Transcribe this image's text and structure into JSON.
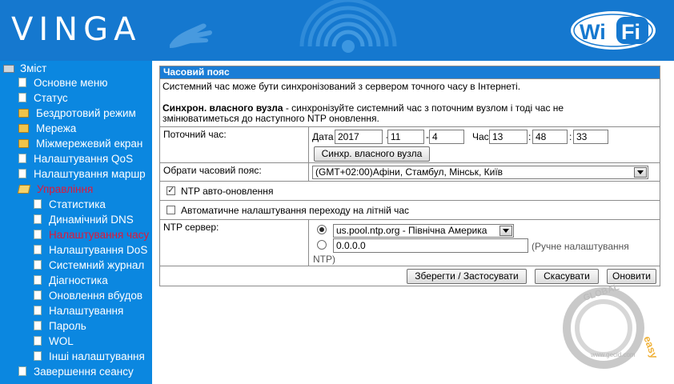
{
  "header": {
    "brand": "VINGA",
    "wifi_logo": {
      "left": "Wi",
      "right": "Fi"
    }
  },
  "sidebar": {
    "root": "Зміст",
    "items": [
      {
        "label": "Основне меню",
        "icon": "document-icon"
      },
      {
        "label": "Статус",
        "icon": "document-icon"
      },
      {
        "label": "Бездротовий режим",
        "icon": "folder-icon"
      },
      {
        "label": "Мережа",
        "icon": "folder-icon"
      },
      {
        "label": "Міжмережевий екран",
        "icon": "folder-icon"
      },
      {
        "label": "Налаштування QoS",
        "icon": "document-icon"
      },
      {
        "label": "Налаштування маршр",
        "icon": "document-icon"
      },
      {
        "label": "Управління",
        "icon": "folder-open-icon",
        "active": true
      },
      {
        "label": "Статистика",
        "icon": "document-icon"
      },
      {
        "label": "Динамічний DNS",
        "icon": "document-icon"
      },
      {
        "label": "Налаштування часу",
        "icon": "document-icon",
        "active": true
      },
      {
        "label": "Налаштування DoS",
        "icon": "document-icon"
      },
      {
        "label": "Системний журнал",
        "icon": "document-icon"
      },
      {
        "label": "Діагностика",
        "icon": "document-icon"
      },
      {
        "label": "Оновлення вбудов",
        "icon": "document-icon"
      },
      {
        "label": "Налаштування",
        "icon": "document-icon"
      },
      {
        "label": "Пароль",
        "icon": "document-icon"
      },
      {
        "label": "WOL",
        "icon": "document-icon"
      },
      {
        "label": "Інші налаштування",
        "icon": "document-icon"
      },
      {
        "label": "Завершення сеансу",
        "icon": "document-icon"
      }
    ]
  },
  "panel": {
    "title": "Часовий пояс",
    "intro_line1": "Системний час може бути синхронізований з сервером точного часу в Інтернеті.",
    "sync_bold": "Синхрон. власного вузла",
    "sync_rest": " - синхронізуйте системний час з поточним вузлом і тоді час не",
    "sync_line2": "змінюватиметься до наступного NTP оновлення.",
    "current_time_label": "Поточний час:",
    "date_label": "Дата",
    "time_label": "Час",
    "year": "2017",
    "month": "11",
    "day": "4",
    "hour": "13",
    "minute": "48",
    "second": "33",
    "sep_dash": "-",
    "sep_colon": ":",
    "sync_button": "Синхр. власного вузла",
    "timezone_label": "Обрати часовий пояс:",
    "timezone_value": "(GMT+02:00)Афіни, Стамбул, Мінськ, Київ",
    "ntp_auto_label": "NTP авто-оновлення",
    "ntp_auto_checked": true,
    "dst_label": "Автоматичне налаштування переходу на літній час",
    "dst_checked": false,
    "ntp_server_label": "NTP сервер:",
    "ntp_server_value": "us.pool.ntp.org - Північна Америка",
    "ntp_manual_value": "0.0.0.0",
    "ntp_manual_hint": "(Ручне налаштування",
    "ntp_manual_hint2": "NTP)",
    "save_button": "Зберегти / Застосувати",
    "cancel_button": "Скасувати",
    "refresh_button": "Оновити"
  },
  "watermark": {
    "word_top": "GLOBAL",
    "word_side": "easy",
    "url": "www.gecid.com"
  }
}
